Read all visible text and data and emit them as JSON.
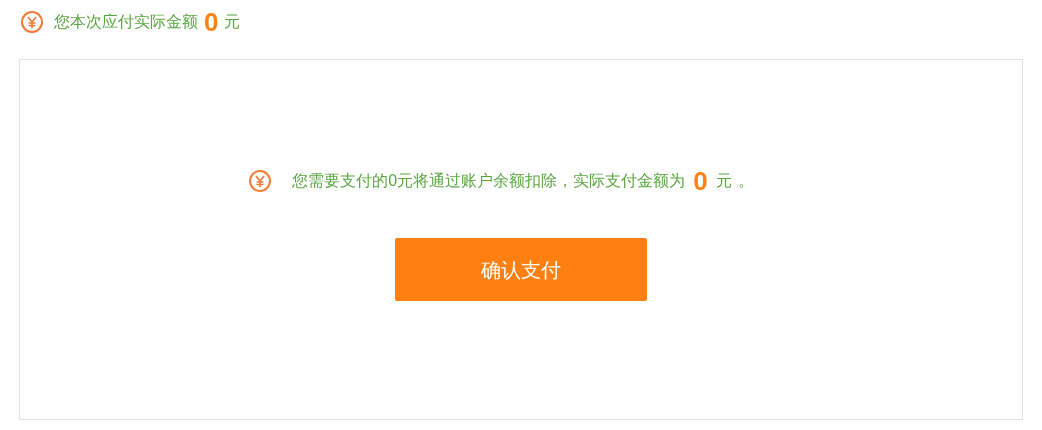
{
  "header": {
    "label": "您本次应付实际金额",
    "amount": "0",
    "unit": "元"
  },
  "notice": {
    "message": "您需要支付的0元将通过账户余额扣除，实际支付金额为",
    "amount": "0",
    "unit": "元",
    "end": "。"
  },
  "buttons": [
    "确认支付"
  ]
}
